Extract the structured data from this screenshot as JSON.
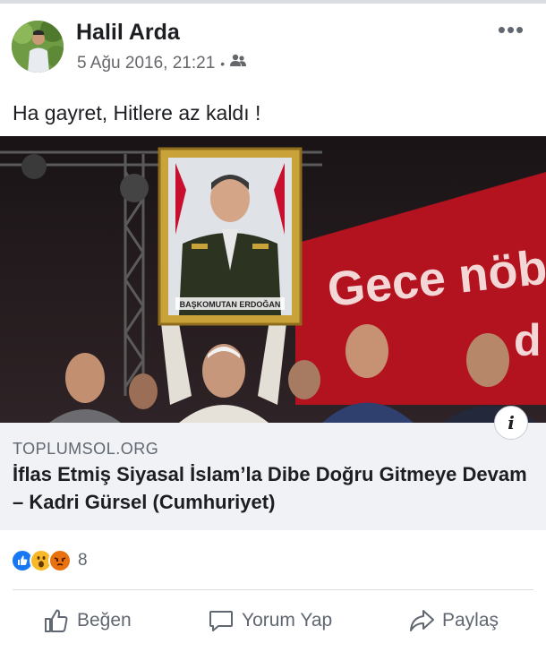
{
  "post": {
    "author": "Halil Arda",
    "timestamp": "5 Ağu 2016, 21:21",
    "separator": "•",
    "audience_icon": "friends-icon",
    "more_label": "•••",
    "text": "Ha gayret, Hitlere az kaldı !"
  },
  "link_preview": {
    "image_banner_text": "Gece nöb",
    "image_banner_text_2": "d",
    "portrait_caption": "BAŞKOMUTAN ERDOĞAN",
    "info_label": "i",
    "domain": "TOPLUMSOL.ORG",
    "headline": "İflas Etmiş Siyasal İslam’la Dibe Doğru Gitmeye Devam – Kadri Gürsel (Cumhuriyet)"
  },
  "reactions": {
    "icons": [
      "like-reaction-icon",
      "wow-reaction-icon",
      "angry-reaction-icon"
    ],
    "count": "8"
  },
  "actions": {
    "like": "Beğen",
    "comment": "Yorum Yap",
    "share": "Paylaş"
  },
  "colors": {
    "text": "#1c1e21",
    "secondary": "#606770",
    "like_blue": "#1877f2",
    "wow_yellow": "#f7b928",
    "angry_orange": "#e9710f",
    "preview_bg": "#f0f2f5",
    "banner_red": "#b3121f"
  }
}
